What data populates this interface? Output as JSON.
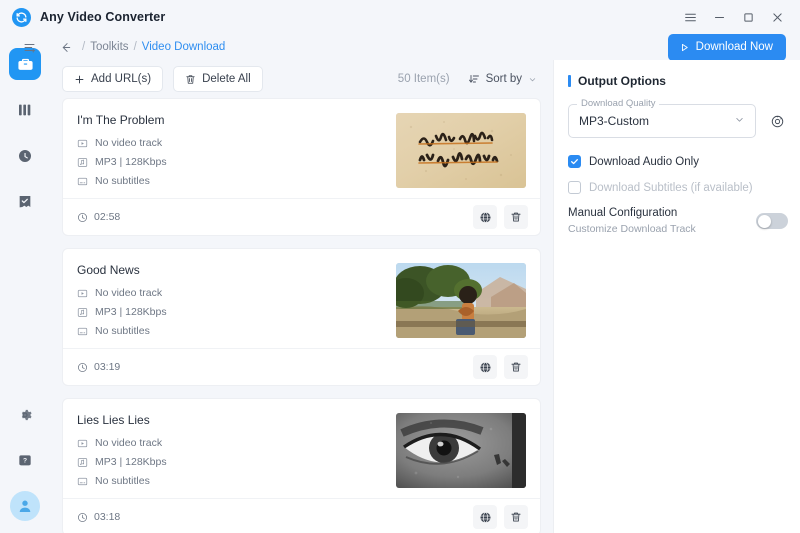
{
  "window": {
    "app_title": "Any Video Converter",
    "logo_icon": "circular-arrows-logo",
    "controls": [
      {
        "name": "menu-button",
        "icon": "hamburger-icon"
      },
      {
        "name": "minimize-button",
        "icon": "minimize-icon"
      },
      {
        "name": "maximize-button",
        "icon": "maximize-icon"
      },
      {
        "name": "close-button",
        "icon": "close-icon"
      }
    ]
  },
  "sidebar": {
    "items": [
      {
        "name": "sidebar-item-toolkits",
        "icon": "toolbox-icon",
        "active": true
      },
      {
        "name": "sidebar-item-library",
        "icon": "library-icon",
        "active": false
      },
      {
        "name": "sidebar-item-history",
        "icon": "clock-icon",
        "active": false
      },
      {
        "name": "sidebar-item-tasks",
        "icon": "task-list-icon",
        "active": false
      }
    ],
    "bottom": [
      {
        "name": "sidebar-item-settings",
        "icon": "gear-icon"
      },
      {
        "name": "sidebar-item-help",
        "icon": "help-icon"
      }
    ],
    "avatar_icon": "user-avatar-icon"
  },
  "breadcrumb": {
    "collapse_icon": "sidebar-toggle-icon",
    "back_icon": "arrow-left-icon",
    "sep": "/",
    "parent": "Toolkits",
    "current": "Video Download"
  },
  "header": {
    "download_now_label": "Download Now",
    "download_now_icon": "play-icon",
    "accent_color": "#2b8bf2"
  },
  "toolbar": {
    "add_url_label": "Add URL(s)",
    "add_url_icon": "plus-icon",
    "delete_all_label": "Delete All",
    "delete_all_icon": "trash-icon",
    "item_count": "50 Item(s)",
    "sort_label": "Sort by",
    "sort_icon": "sort-icon",
    "sort_caret_icon": "chevron-down-icon"
  },
  "list": {
    "video_icon": "video-track-icon",
    "audio_icon": "audio-track-icon",
    "subtitle_icon": "subtitle-icon",
    "duration_icon": "clock-icon",
    "browser_icon": "globe-icon",
    "delete_icon": "trash-icon",
    "items": [
      {
        "title": "I'm The Problem",
        "video": "No video track",
        "audio": "MP3 | 128Kbps",
        "subtitles": "No subtitles",
        "duration": "02:58",
        "thumb": "parchment-handwritten-cover"
      },
      {
        "title": "Good News",
        "video": "No video track",
        "audio": "MP3 | 128Kbps",
        "subtitles": "No subtitles",
        "duration": "03:19",
        "thumb": "outdoor-guitar-photo"
      },
      {
        "title": "Lies Lies Lies",
        "video": "No video track",
        "audio": "MP3 | 128Kbps",
        "subtitles": "No subtitles",
        "duration": "03:18",
        "thumb": "black-white-eye-photo"
      }
    ]
  },
  "options": {
    "heading": "Output Options",
    "quality_label": "Download Quality",
    "quality_value": "MP3-Custom",
    "quality_caret_icon": "chevron-down-icon",
    "settings_icon": "gear-circle-icon",
    "audio_only_label": "Download Audio Only",
    "audio_only_checked": true,
    "subtitles_label": "Download Subtitles (if available)",
    "subtitles_checked": false,
    "subtitles_disabled": true,
    "manual_title": "Manual Configuration",
    "manual_sub": "Customize Download Track",
    "manual_toggle_on": false
  }
}
